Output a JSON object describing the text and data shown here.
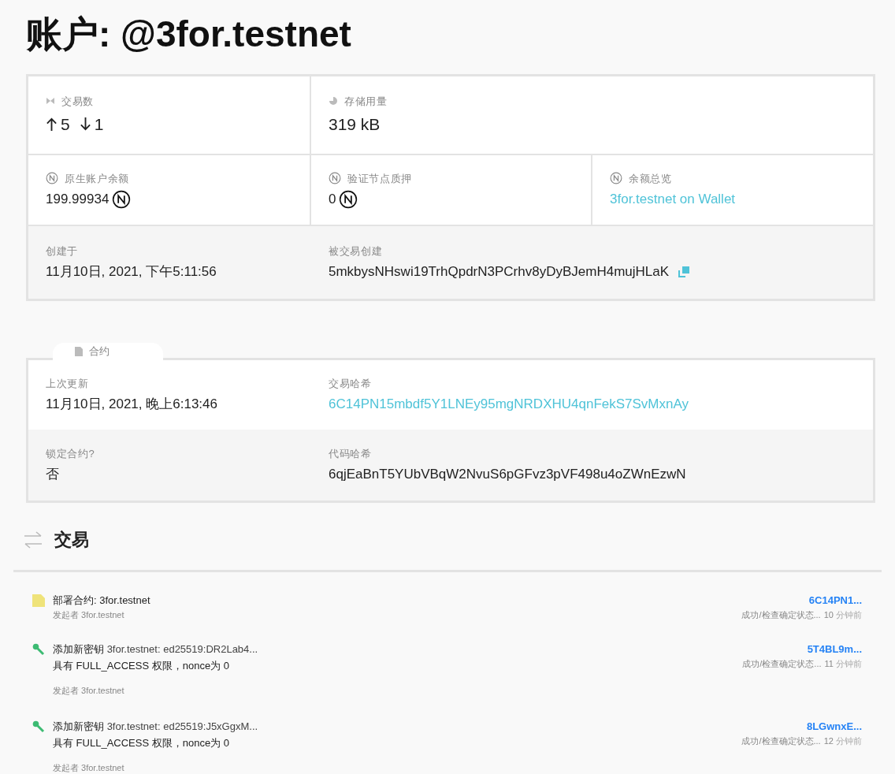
{
  "title": "账户: @3for.testnet",
  "overview": {
    "rows": [
      {
        "shaded": false,
        "cells": [
          {
            "label": "交易数",
            "kind": "counts",
            "out": "5",
            "in": "1"
          },
          {
            "label": "存储用量",
            "kind": "big",
            "value": "319 kB"
          }
        ]
      },
      {
        "shaded": false,
        "cells": [
          {
            "label": "原生账户余额",
            "kind": "near",
            "value": "199.99934"
          },
          {
            "label": "验证节点质押",
            "kind": "near",
            "value": "0"
          },
          {
            "label": "余额总览",
            "kind": "link",
            "value": "3for.testnet on Wallet"
          }
        ]
      },
      {
        "shaded": true,
        "cells": [
          {
            "label": "创建于",
            "kind": "text",
            "value": "11月10日, 2021, 下午5:11:56"
          },
          {
            "label": "被交易创建",
            "kind": "copy",
            "value": "5mkbysNHswi19TrhQpdrN3PCrhv8yDyBJemH4mujHLaK"
          }
        ]
      }
    ]
  },
  "contract": {
    "tab": "合约",
    "rows": [
      {
        "cells": [
          {
            "label": "上次更新",
            "kind": "text",
            "value": "11月10日, 2021, 晚上6:13:46"
          },
          {
            "label": "交易哈希",
            "kind": "link",
            "value": "6C14PN15mbdf5Y1LNEy95mgNRDXHU4qnFekS7SvMxnAy"
          }
        ]
      },
      {
        "cells": [
          {
            "label": "锁定合约?",
            "kind": "text",
            "value": "否"
          },
          {
            "label": "代码哈希",
            "kind": "text",
            "value": "6qjEaBnT5YUbVBqW2NvuS6pGFvz3pVF498u4oZWnEzwN"
          }
        ]
      }
    ]
  },
  "transactions": {
    "heading": "交易",
    "items": [
      {
        "kind": "contract",
        "action": "部署合约: 3for.testnet",
        "signer": "发起者 3for.testnet",
        "hash": "6C14PN1...",
        "status": "成功/检查确定状态...",
        "count": "10",
        "unit": "分钟前"
      },
      {
        "kind": "key",
        "action": "添加新密钥",
        "detail": "3for.testnet: ed25519:DR2Lab4...",
        "line2": "具有 FULL_ACCESS 权限，nonce为 0",
        "signer": "发起者 3for.testnet",
        "hash": "5T4BL9m...",
        "status": "成功/检查确定状态...",
        "count": "11",
        "unit": "分钟前"
      },
      {
        "kind": "key",
        "action": "添加新密钥",
        "detail": "3for.testnet: ed25519:J5xGgxM...",
        "line2": "具有 FULL_ACCESS 权限，nonce为 0",
        "signer": "发起者 3for.testnet",
        "hash": "8LGwnxE...",
        "status": "成功/检查确定状态...",
        "count": "12",
        "unit": "分钟前"
      }
    ]
  }
}
